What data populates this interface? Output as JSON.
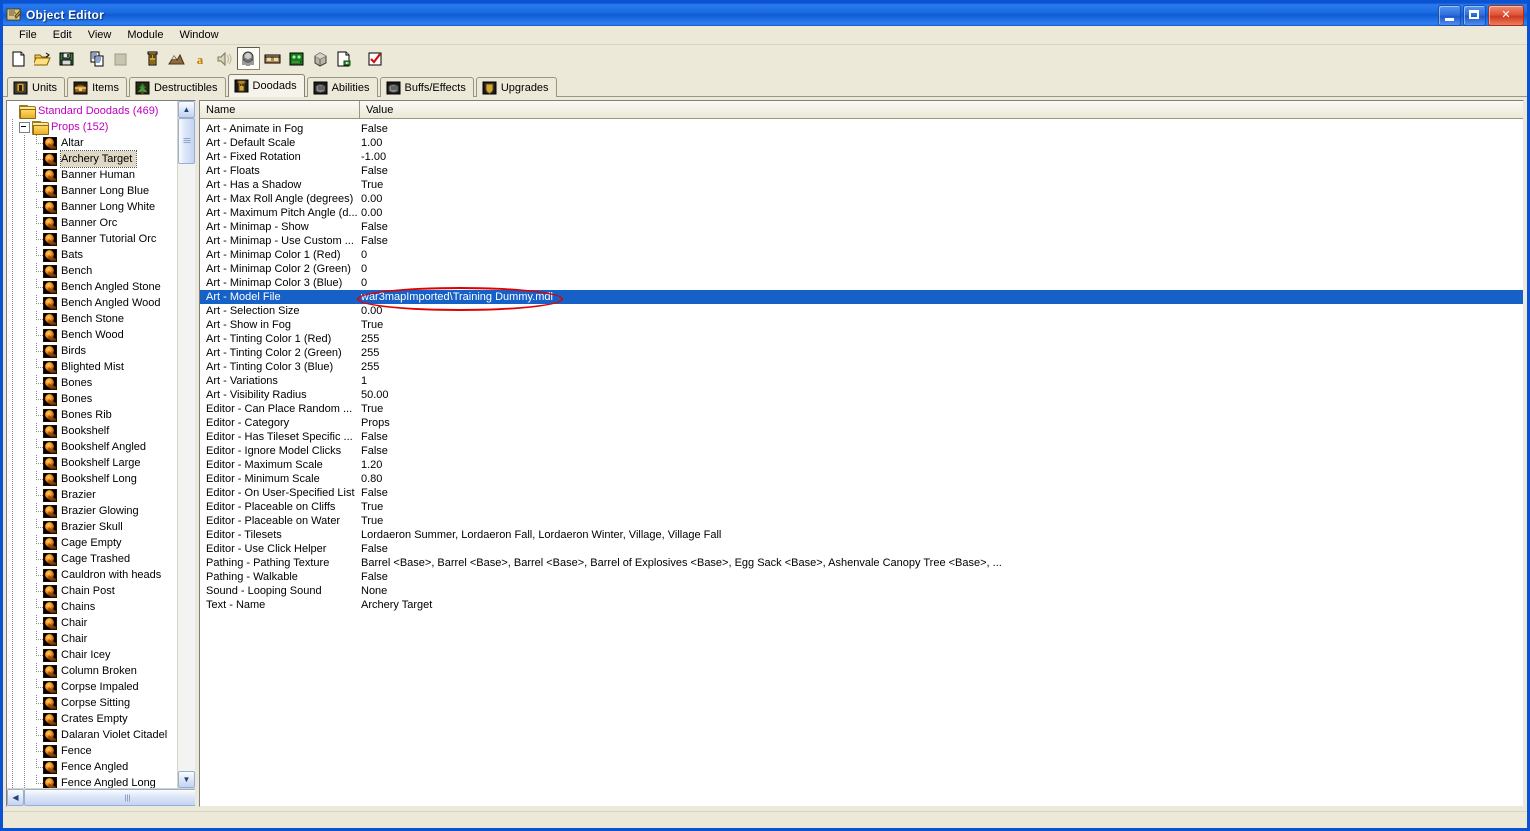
{
  "window": {
    "title": "Object Editor",
    "icon": "scroll-icon",
    "minimize_label": "Minimize",
    "maximize_label": "Maximize",
    "close_label": "Close"
  },
  "menu": {
    "items": [
      {
        "label": "File"
      },
      {
        "label": "Edit"
      },
      {
        "label": "View"
      },
      {
        "label": "Module"
      },
      {
        "label": "Window"
      }
    ]
  },
  "toolbar": {
    "buttons": [
      {
        "name": "new-icon",
        "tip": "New"
      },
      {
        "name": "open-folder-icon",
        "tip": "Open"
      },
      {
        "name": "save-disk-icon",
        "tip": "Save"
      },
      {
        "name": "copy-icon",
        "tip": "Copy"
      },
      {
        "name": "paste-icon",
        "tip": "Paste"
      },
      {
        "name": "terrain-editor-icon",
        "tip": "Terrain Editor"
      },
      {
        "name": "mountain-icon",
        "tip": "Terrain Palette"
      },
      {
        "name": "trigger-editor-icon",
        "tip": "Trigger Editor"
      },
      {
        "name": "sound-editor-icon",
        "tip": "Sound Editor"
      },
      {
        "name": "object-editor-icon",
        "tip": "Object Editor"
      },
      {
        "name": "campaign-editor-icon",
        "tip": "Campaign Editor"
      },
      {
        "name": "ai-editor-icon",
        "tip": "AI Editor"
      },
      {
        "name": "object-manager-icon",
        "tip": "Object Manager"
      },
      {
        "name": "import-manager-icon",
        "tip": "Import Manager"
      },
      {
        "name": "test-map-icon",
        "tip": "Test Map"
      }
    ]
  },
  "tabs": [
    {
      "label": "Units",
      "icon": "helmet-icon",
      "active": false
    },
    {
      "label": "Items",
      "icon": "chest-icon",
      "active": false
    },
    {
      "label": "Destructibles",
      "icon": "tree-icon",
      "active": false
    },
    {
      "label": "Doodads",
      "icon": "tower-icon",
      "active": true
    },
    {
      "label": "Abilities",
      "icon": "fist-icon",
      "active": false
    },
    {
      "label": "Buffs/Effects",
      "icon": "fist-icon",
      "active": false
    },
    {
      "label": "Upgrades",
      "icon": "shield-icon",
      "active": false
    }
  ],
  "tree": {
    "root": {
      "label": "Standard Doodads (469)"
    },
    "category": {
      "label": "Props (152)"
    },
    "selected": "Archery Target",
    "items": [
      "Altar",
      "Archery Target",
      "Banner Human",
      "Banner Long Blue",
      "Banner Long White",
      "Banner Orc",
      "Banner Tutorial Orc",
      "Bats",
      "Bench",
      "Bench Angled Stone",
      "Bench Angled Wood",
      "Bench Stone",
      "Bench Wood",
      "Birds",
      "Blighted Mist",
      "Bones",
      "Bones",
      "Bones Rib",
      "Bookshelf",
      "Bookshelf Angled",
      "Bookshelf Large",
      "Bookshelf Long",
      "Brazier",
      "Brazier Glowing",
      "Brazier Skull",
      "Cage Empty",
      "Cage Trashed",
      "Cauldron with heads",
      "Chain Post",
      "Chains",
      "Chair",
      "Chair",
      "Chair Icey",
      "Column Broken",
      "Corpse Impaled",
      "Corpse Sitting",
      "Crates Empty",
      "Dalaran Violet Citadel",
      "Fence",
      "Fence Angled",
      "Fence Angled Long"
    ]
  },
  "properties": {
    "columns": [
      "Name",
      "Value"
    ],
    "selected_index": 12,
    "rows": [
      {
        "name": "Art - Animate in Fog",
        "value": "False"
      },
      {
        "name": "Art - Default Scale",
        "value": "1.00"
      },
      {
        "name": "Art - Fixed Rotation",
        "value": "-1.00"
      },
      {
        "name": "Art - Floats",
        "value": "False"
      },
      {
        "name": "Art - Has a Shadow",
        "value": "True"
      },
      {
        "name": "Art - Max Roll Angle (degrees)",
        "value": "0.00"
      },
      {
        "name": "Art - Maximum Pitch Angle (d...",
        "value": "0.00"
      },
      {
        "name": "Art - Minimap - Show",
        "value": "False"
      },
      {
        "name": "Art - Minimap - Use Custom ...",
        "value": "False"
      },
      {
        "name": "Art - Minimap Color 1 (Red)",
        "value": "0"
      },
      {
        "name": "Art - Minimap Color 2 (Green)",
        "value": "0"
      },
      {
        "name": "Art - Minimap Color 3 (Blue)",
        "value": "0"
      },
      {
        "name": "Art - Model File",
        "value": "war3mapImported\\Training Dummy.mdl"
      },
      {
        "name": "Art - Selection Size",
        "value": "0.00"
      },
      {
        "name": "Art - Show in Fog",
        "value": "True"
      },
      {
        "name": "Art - Tinting Color 1 (Red)",
        "value": "255"
      },
      {
        "name": "Art - Tinting Color 2 (Green)",
        "value": "255"
      },
      {
        "name": "Art - Tinting Color 3 (Blue)",
        "value": "255"
      },
      {
        "name": "Art - Variations",
        "value": "1"
      },
      {
        "name": "Art - Visibility Radius",
        "value": "50.00"
      },
      {
        "name": "Editor - Can Place Random ...",
        "value": "True"
      },
      {
        "name": "Editor - Category",
        "value": "Props"
      },
      {
        "name": "Editor - Has Tileset Specific ...",
        "value": "False"
      },
      {
        "name": "Editor - Ignore Model Clicks",
        "value": "False"
      },
      {
        "name": "Editor - Maximum Scale",
        "value": "1.20"
      },
      {
        "name": "Editor - Minimum Scale",
        "value": "0.80"
      },
      {
        "name": "Editor - On User-Specified List",
        "value": "False"
      },
      {
        "name": "Editor - Placeable on Cliffs",
        "value": "True"
      },
      {
        "name": "Editor - Placeable on Water",
        "value": "True"
      },
      {
        "name": "Editor - Tilesets",
        "value": "Lordaeron Summer, Lordaeron Fall, Lordaeron Winter, Village, Village Fall"
      },
      {
        "name": "Editor - Use Click Helper",
        "value": "False"
      },
      {
        "name": "Pathing - Pathing Texture",
        "value": "Barrel <Base>, Barrel <Base>, Barrel <Base>, Barrel of Explosives <Base>, Egg Sack <Base>, Ashenvale Canopy Tree <Base>, ..."
      },
      {
        "name": "Pathing - Walkable",
        "value": "False"
      },
      {
        "name": "Sound - Looping Sound",
        "value": "None"
      },
      {
        "name": "Text - Name",
        "value": "Archery Target"
      }
    ]
  },
  "annotation": {
    "shape": "ellipse",
    "color": "#e00000",
    "target_text": "war3mapImported\\Training Dummy.mdl"
  },
  "colors": {
    "titlebar_blue": "#0a58d4",
    "selection_blue": "#1661c8",
    "category_magenta": "#c000c0",
    "window_face": "#ece9d8",
    "annotation_red": "#e00000"
  }
}
